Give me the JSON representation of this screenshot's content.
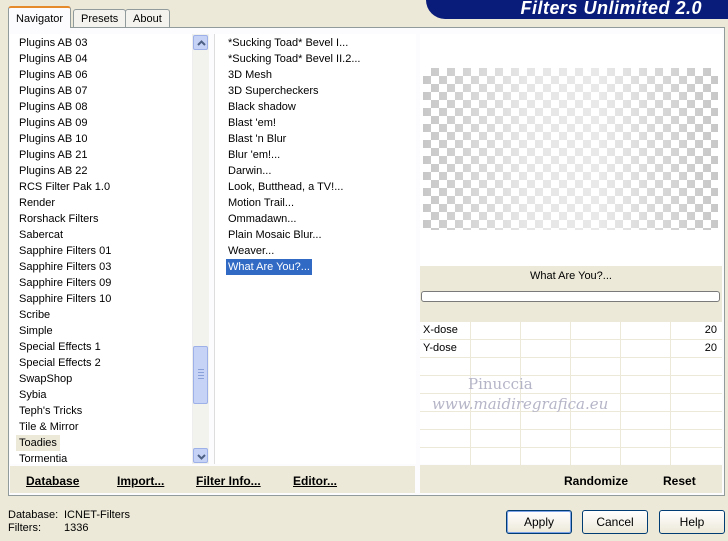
{
  "tabs": [
    {
      "label": "Navigator",
      "active": true
    },
    {
      "label": "Presets",
      "active": false
    },
    {
      "label": "About",
      "active": false
    }
  ],
  "banner_title": "Filters Unlimited 2.0",
  "categories": [
    "Plugins AB 03",
    "Plugins AB 04",
    "Plugins AB 06",
    "Plugins AB 07",
    "Plugins AB 08",
    "Plugins AB 09",
    "Plugins AB 10",
    "Plugins AB 21",
    "Plugins AB 22",
    "RCS Filter Pak 1.0",
    "Render",
    "Rorshack Filters",
    "Sabercat",
    "Sapphire Filters 01",
    "Sapphire Filters 03",
    "Sapphire Filters 09",
    "Sapphire Filters 10",
    "Scribe",
    "Simple",
    "Special Effects 1",
    "Special Effects 2",
    "SwapShop",
    "Sybia",
    "Teph's Tricks",
    "Tile & Mirror",
    "Toadies",
    "Tormentia"
  ],
  "selected_category": "Toadies",
  "filters": [
    "*Sucking Toad*  Bevel I...",
    "*Sucking Toad*  Bevel II.2...",
    "3D Mesh",
    "3D Supercheckers",
    "Black shadow",
    "Blast 'em!",
    "Blast 'n Blur",
    "Blur 'em!...",
    "Darwin...",
    "Look, Butthead, a TV!...",
    "Motion Trail...",
    "Ommadawn...",
    "Plain Mosaic Blur...",
    "Weaver...",
    "What Are You?..."
  ],
  "selected_filter": "What Are You?...",
  "preview_filter_name": "What Are You?...",
  "params": [
    {
      "label": "X-dose",
      "value": "20"
    },
    {
      "label": "Y-dose",
      "value": "20"
    }
  ],
  "watermark": {
    "line1": "Pinuccia",
    "line2": "www.maidiregrafica.eu"
  },
  "left_buttons": {
    "database": "Database",
    "import": "Import...",
    "filter_info": "Filter Info...",
    "editor": "Editor..."
  },
  "right_buttons": {
    "randomize": "Randomize",
    "reset": "Reset"
  },
  "status": {
    "database_label": "Database:",
    "database_value": "ICNET-Filters",
    "filters_label": "Filters:",
    "filters_value": "1336"
  },
  "dialog_buttons": {
    "apply": "Apply",
    "cancel": "Cancel",
    "help": "Help"
  }
}
